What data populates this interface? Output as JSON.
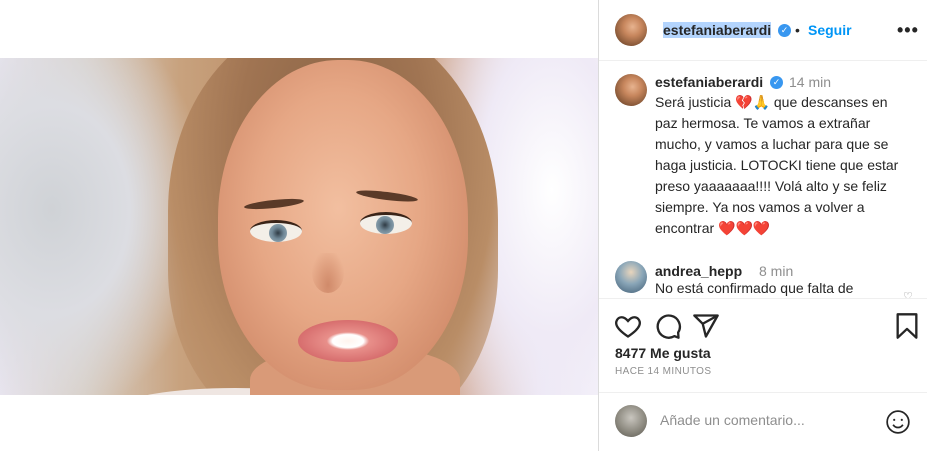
{
  "header": {
    "username": "estefaniaberardi",
    "separator": "•",
    "follow_label": "Seguir",
    "more_label": "•••"
  },
  "caption": {
    "username": "estefaniaberardi",
    "time": "14 min",
    "text": "Será justicia 💔🙏 que descanses en paz hermosa. Te vamos a extrañar mucho, y vamos a luchar para que se haga justicia. LOTOCKI tiene que estar preso yaaaaaaa!!!! Volá alto y se feliz siempre. Ya nos vamos a volver a encontrar ❤️❤️❤️"
  },
  "comments": [
    {
      "username": "andrea_hepp",
      "time": "8 min",
      "text": "No está confirmado que falta de"
    }
  ],
  "actions": {
    "likes": "8477 Me gusta",
    "time_ago": "HACE 14 MINUTOS"
  },
  "add_comment": {
    "placeholder": "Añade un comentario..."
  },
  "colors": {
    "accent": "#0095f6",
    "verified": "#3897f0",
    "muted": "#8e8e8e",
    "selection": "#b3d4fd"
  },
  "icons": [
    "heart-icon",
    "comment-icon",
    "share-icon",
    "bookmark-icon",
    "emoji-icon",
    "verified-icon"
  ]
}
